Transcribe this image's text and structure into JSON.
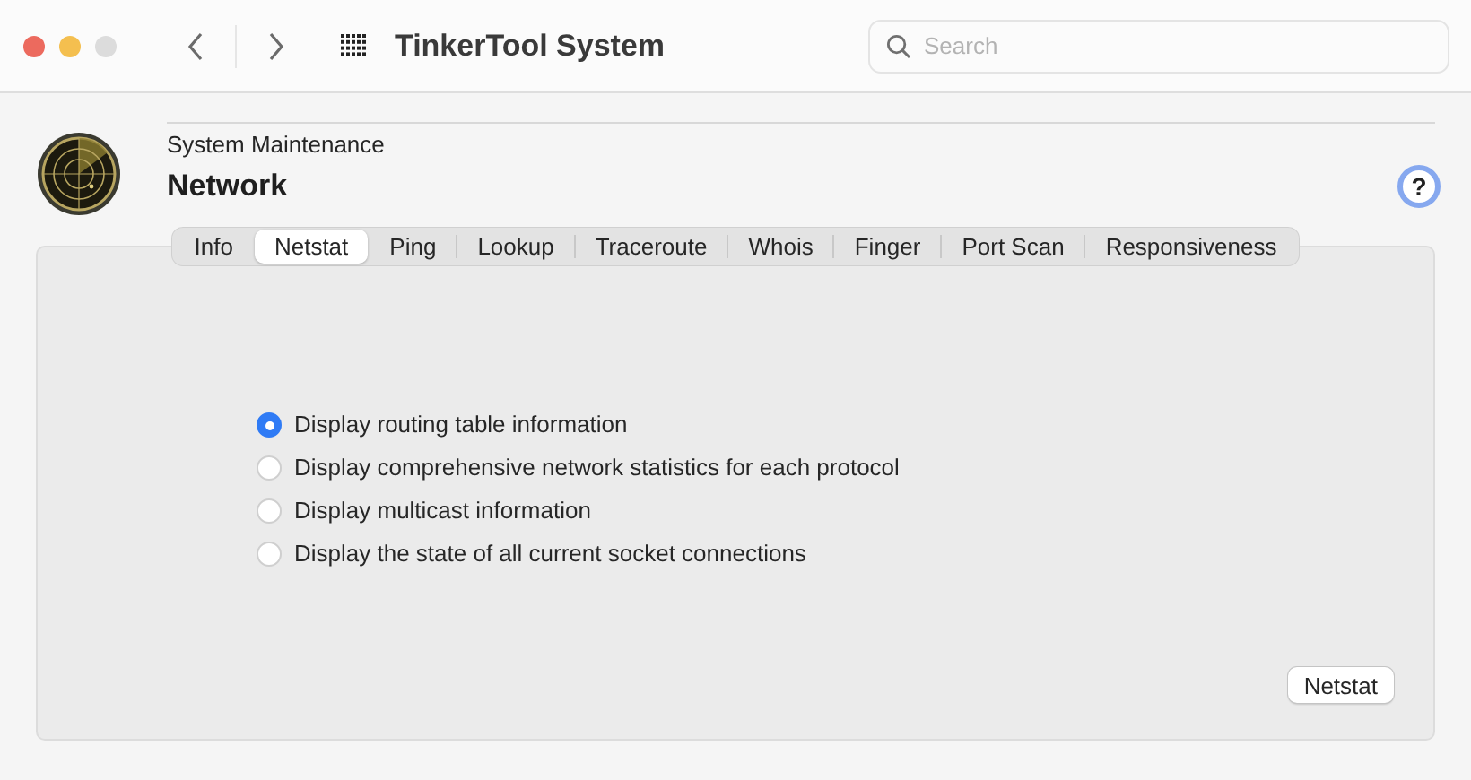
{
  "window": {
    "title": "TinkerTool System"
  },
  "search": {
    "placeholder": "Search"
  },
  "header": {
    "category": "System Maintenance",
    "title": "Network",
    "help": "?"
  },
  "tabs": [
    {
      "label": "Info",
      "selected": false
    },
    {
      "label": "Netstat",
      "selected": true
    },
    {
      "label": "Ping",
      "selected": false
    },
    {
      "label": "Lookup",
      "selected": false
    },
    {
      "label": "Traceroute",
      "selected": false
    },
    {
      "label": "Whois",
      "selected": false
    },
    {
      "label": "Finger",
      "selected": false
    },
    {
      "label": "Port Scan",
      "selected": false
    },
    {
      "label": "Responsiveness",
      "selected": false
    }
  ],
  "options": [
    {
      "label": "Display routing table information",
      "selected": true
    },
    {
      "label": "Display comprehensive network statistics for each protocol",
      "selected": false
    },
    {
      "label": "Display multicast information",
      "selected": false
    },
    {
      "label": "Display the state of all current socket connections",
      "selected": false
    }
  ],
  "action_button": "Netstat"
}
